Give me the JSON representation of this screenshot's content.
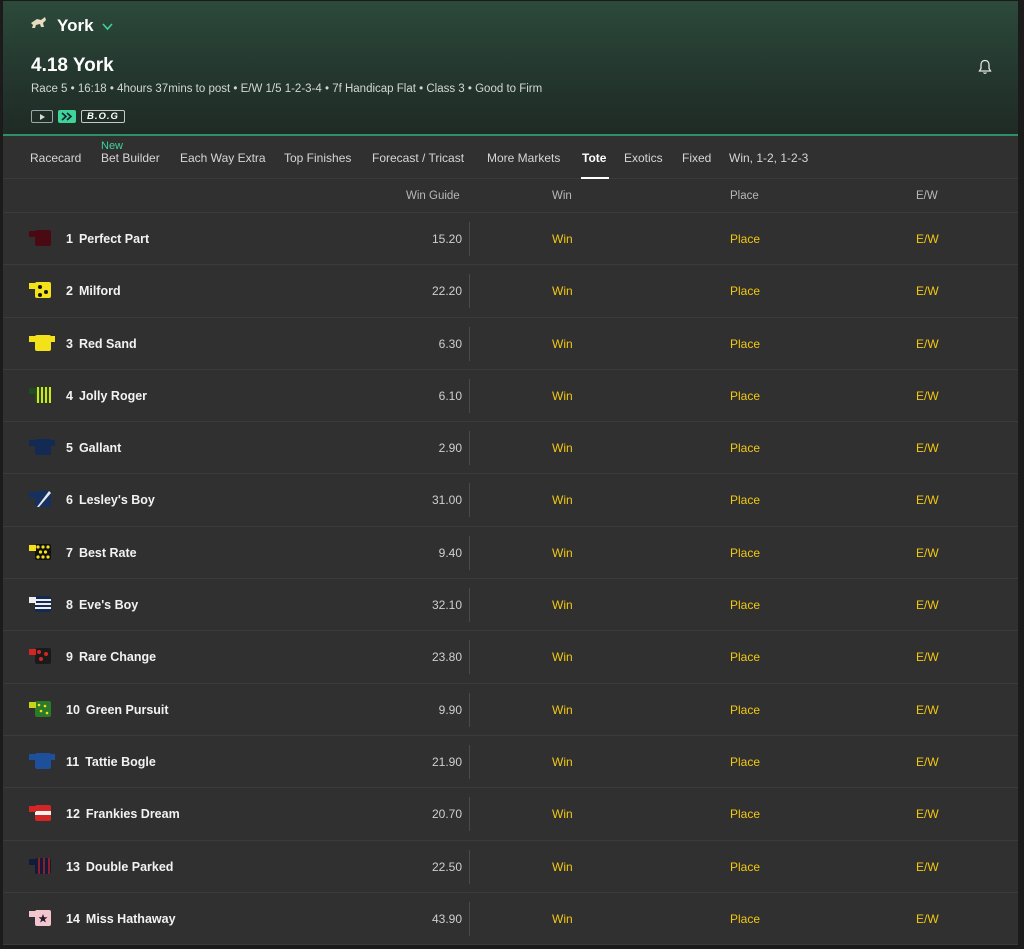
{
  "header": {
    "venue": "York",
    "race_title": "4.18 York",
    "race_info": "Race 5 • 16:18 • 4hours 37mins to post • E/W 1/5 1-2-3-4 • 7f Handicap Flat • Class 3 • Good to Firm",
    "bog_label": "B.O.G"
  },
  "tabs": [
    {
      "label": "Racecard"
    },
    {
      "label": "Bet Builder",
      "badge": "New"
    },
    {
      "label": "Each Way Extra"
    },
    {
      "label": "Top Finishes"
    },
    {
      "label": "Forecast / Tricast"
    },
    {
      "label": "More Markets"
    },
    {
      "label": "Tote",
      "active": true
    },
    {
      "label": "Exotics"
    },
    {
      "label": "Fixed"
    },
    {
      "label": "Win, 1-2, 1-2-3"
    }
  ],
  "columns": {
    "win_guide": "Win Guide",
    "win": "Win",
    "place": "Place",
    "ew": "E/W"
  },
  "runners": [
    {
      "number": "1",
      "name": "Perfect Part",
      "guide": "15.20",
      "win": "Win",
      "place": "Place",
      "ew": "E/W",
      "silk": "maroon-plain"
    },
    {
      "number": "2",
      "name": "Milford",
      "guide": "22.20",
      "win": "Win",
      "place": "Place",
      "ew": "E/W",
      "silk": "yellow-black-spots"
    },
    {
      "number": "3",
      "name": "Red Sand",
      "guide": "6.30",
      "win": "Win",
      "place": "Place",
      "ew": "E/W",
      "silk": "yellow-plain"
    },
    {
      "number": "4",
      "name": "Jolly Roger",
      "guide": "6.10",
      "win": "Win",
      "place": "Place",
      "ew": "E/W",
      "silk": "green-yellow-stripes"
    },
    {
      "number": "5",
      "name": "Gallant",
      "guide": "2.90",
      "win": "Win",
      "place": "Place",
      "ew": "E/W",
      "silk": "navy-plain"
    },
    {
      "number": "6",
      "name": "Lesley's Boy",
      "guide": "31.00",
      "win": "Win",
      "place": "Place",
      "ew": "E/W",
      "silk": "navy-white-sash"
    },
    {
      "number": "7",
      "name": "Best Rate",
      "guide": "9.40",
      "win": "Win",
      "place": "Place",
      "ew": "E/W",
      "silk": "black-yellow-check"
    },
    {
      "number": "8",
      "name": "Eve's Boy",
      "guide": "32.10",
      "win": "Win",
      "place": "Place",
      "ew": "E/W",
      "silk": "navy-white-hoops"
    },
    {
      "number": "9",
      "name": "Rare Change",
      "guide": "23.80",
      "win": "Win",
      "place": "Place",
      "ew": "E/W",
      "silk": "black-red-spots"
    },
    {
      "number": "10",
      "name": "Green Pursuit",
      "guide": "9.90",
      "win": "Win",
      "place": "Place",
      "ew": "E/W",
      "silk": "green-yellow-spots"
    },
    {
      "number": "11",
      "name": "Tattie Bogle",
      "guide": "21.90",
      "win": "Win",
      "place": "Place",
      "ew": "E/W",
      "silk": "blue-plain"
    },
    {
      "number": "12",
      "name": "Frankies Dream",
      "guide": "20.70",
      "win": "Win",
      "place": "Place",
      "ew": "E/W",
      "silk": "red-white-band"
    },
    {
      "number": "13",
      "name": "Double Parked",
      "guide": "22.50",
      "win": "Win",
      "place": "Place",
      "ew": "E/W",
      "silk": "navy-red-stripes"
    },
    {
      "number": "14",
      "name": "Miss Hathaway",
      "guide": "43.90",
      "win": "Win",
      "place": "Place",
      "ew": "E/W",
      "silk": "pink-star"
    }
  ],
  "icons": {
    "venue": "horse-icon",
    "bell": "bell-icon",
    "play": "play-icon",
    "stream": "stream-icon"
  },
  "colors": {
    "accent": "#3fd39a",
    "bet_link": "#f2c811"
  }
}
